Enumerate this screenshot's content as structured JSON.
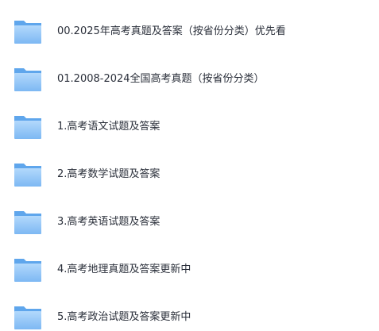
{
  "folders": [
    {
      "name": "00.2025年高考真题及答案（按省份分类）优先看",
      "icon": "folder-icon"
    },
    {
      "name": "01.2008-2024全国高考真题（按省份分类）",
      "icon": "folder-icon"
    },
    {
      "name": "1.高考语文试题及答案",
      "icon": "folder-icon"
    },
    {
      "name": "2.高考数学试题及答案",
      "icon": "folder-icon"
    },
    {
      "name": "3.高考英语试题及答案",
      "icon": "folder-icon"
    },
    {
      "name": "4.高考地理真题及答案更新中",
      "icon": "folder-icon"
    },
    {
      "name": "5.高考政治试题及答案更新中",
      "icon": "folder-icon"
    }
  ],
  "colors": {
    "folder_back": "#5fa6ec",
    "folder_front_top": "#a9d3fb",
    "folder_front_bottom": "#7fbaf4",
    "text": "#2a2f3a"
  }
}
